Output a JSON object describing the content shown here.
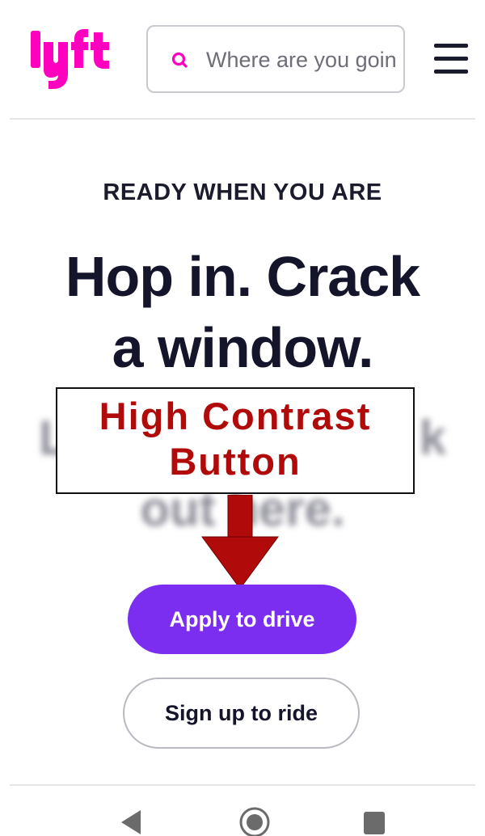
{
  "header": {
    "logo_text": "lyft",
    "search": {
      "placeholder": "Where are you going?"
    },
    "menu_icon": "hamburger-menu-icon"
  },
  "hero": {
    "eyebrow": "READY WHEN YOU ARE",
    "headline_line1": "Hop in. Crack",
    "headline_line2": "a window.",
    "subtext_line1": "L",
    "subtext_line1_end": "k",
    "subtext_line2": "out here."
  },
  "annotation": {
    "line1": "High Contrast",
    "line2": "Button",
    "color": "#b00a0a"
  },
  "actions": {
    "apply_label": "Apply to drive",
    "signup_label": "Sign up to ride"
  },
  "android_nav": {
    "back_icon": "back-triangle-icon",
    "home_icon": "home-circle-icon",
    "recents_icon": "recents-square-icon"
  },
  "colors": {
    "brand_pink": "#ff00bf",
    "primary_purple": "#7b2ef0",
    "text_dark": "#14142b"
  }
}
